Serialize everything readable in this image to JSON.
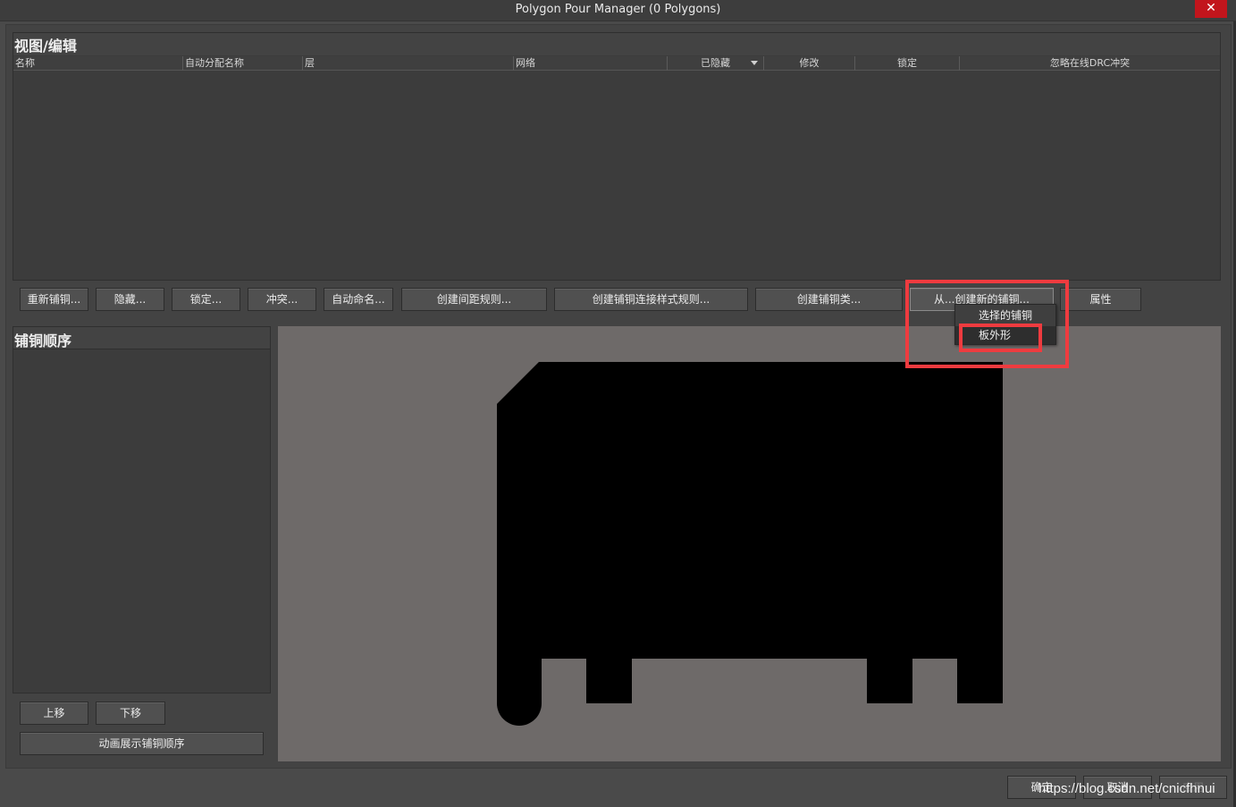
{
  "window": {
    "title": "Polygon Pour Manager (0 Polygons)",
    "close_glyph": "✕"
  },
  "view_edit": {
    "heading": "视图/编辑",
    "columns": [
      "名称",
      "自动分配名称",
      "层",
      "网络",
      "已隐藏",
      "修改",
      "锁定",
      "忽略在线DRC冲突"
    ],
    "rows": []
  },
  "toolbar": {
    "buttons": [
      "重新铺铜...",
      "隐藏...",
      "锁定...",
      "冲突...",
      "自动命名...",
      "创建间距规则...",
      "创建铺铜连接样式规则...",
      "创建铺铜类...",
      "从...创建新的铺铜...",
      "属性"
    ]
  },
  "create_from_menu": {
    "items": [
      "选择的铺铜",
      "板外形"
    ]
  },
  "pour_order": {
    "heading": "铺铜顺序",
    "items": [],
    "move_up": "上移",
    "move_down": "下移",
    "animate": "动画展示铺铜顺序"
  },
  "dialog_buttons": {
    "ok": "确定",
    "cancel": "取消",
    "apply": "应用"
  },
  "watermark": "https://blog.csdn.net/cnicfhnui",
  "colors": {
    "highlight": "#ef3b3f",
    "preview_bg": "#6e6a69",
    "board_shape": "#000000",
    "close_button": "#c2151c"
  },
  "icons": {
    "sort": "triangle-down",
    "close": "close-x"
  }
}
